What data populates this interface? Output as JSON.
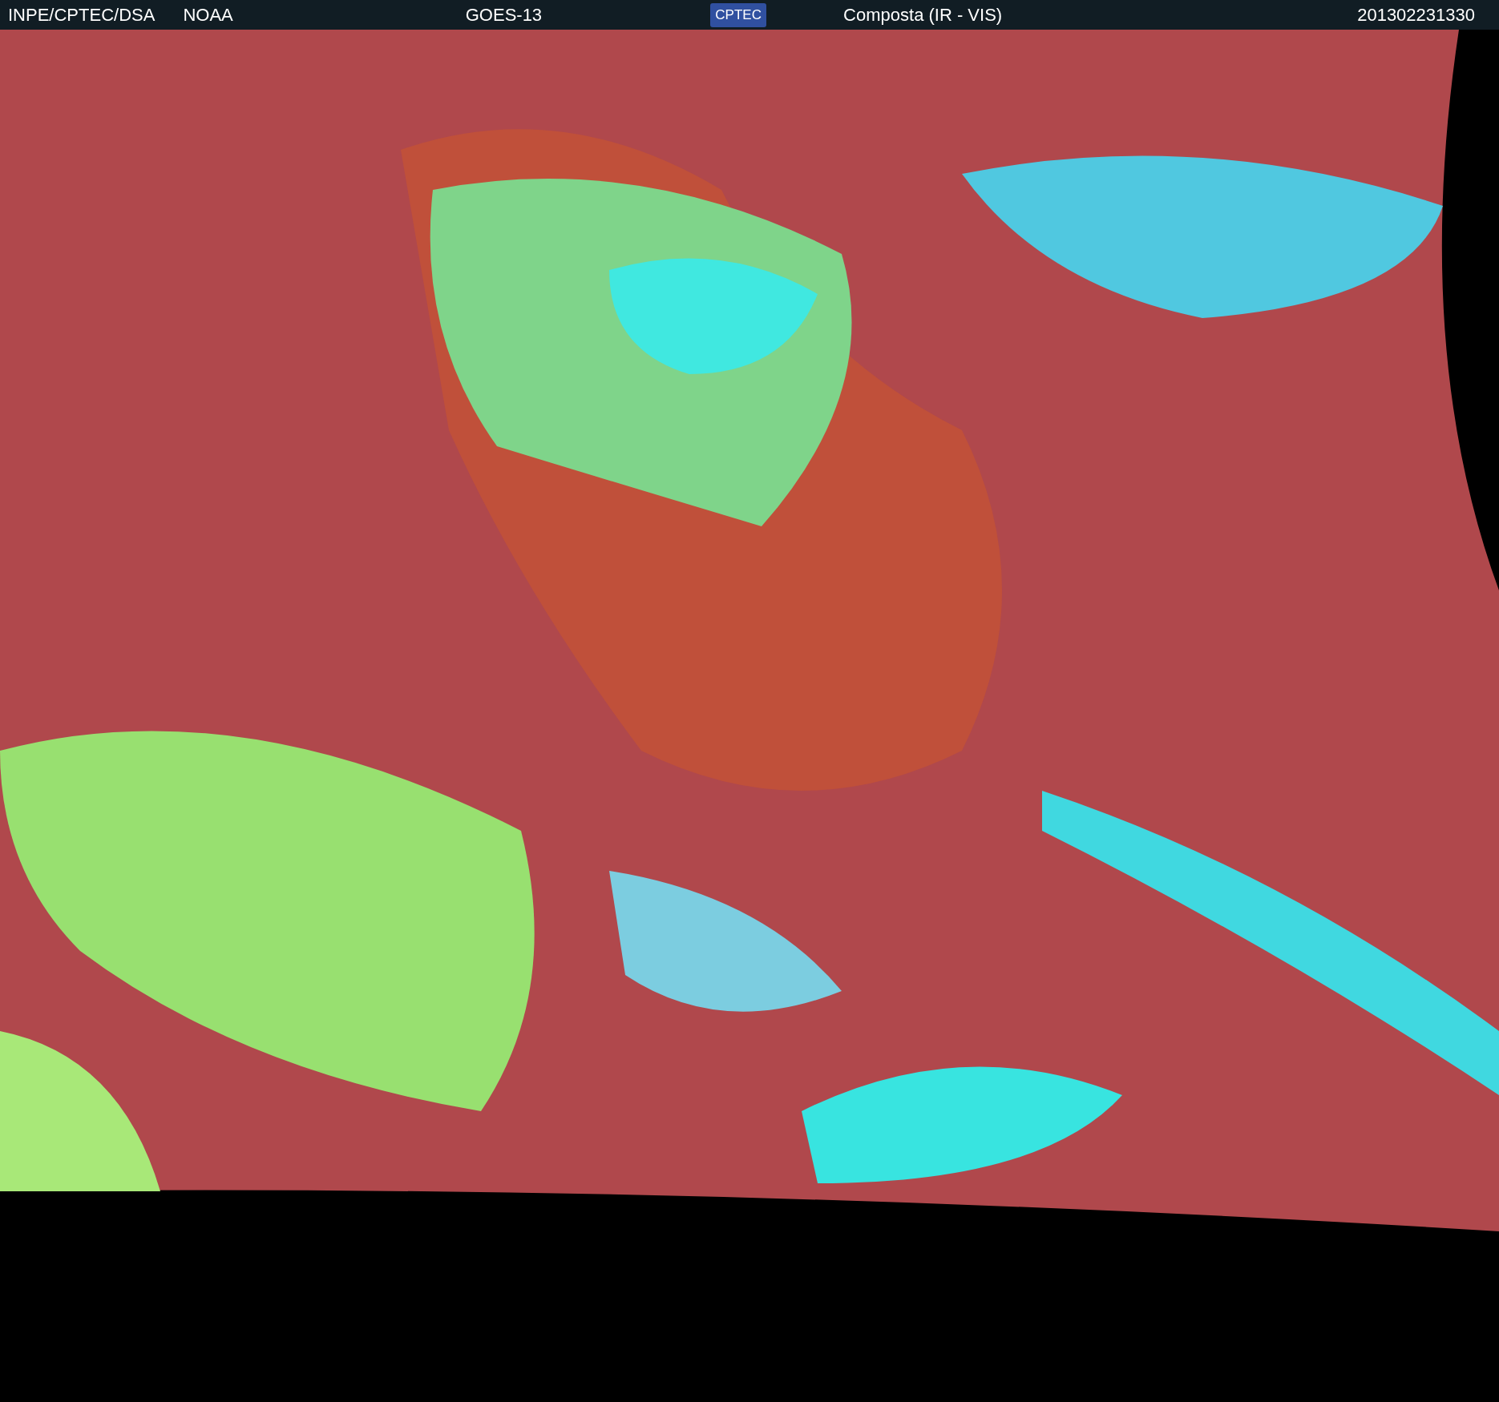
{
  "header": {
    "source": "INPE/CPTEC/DSA",
    "agency": "NOAA",
    "satellite": "GOES-13",
    "logo_text": "CPTEC",
    "product": "Composta (IR - VIS)",
    "timestamp": "201302231330"
  }
}
